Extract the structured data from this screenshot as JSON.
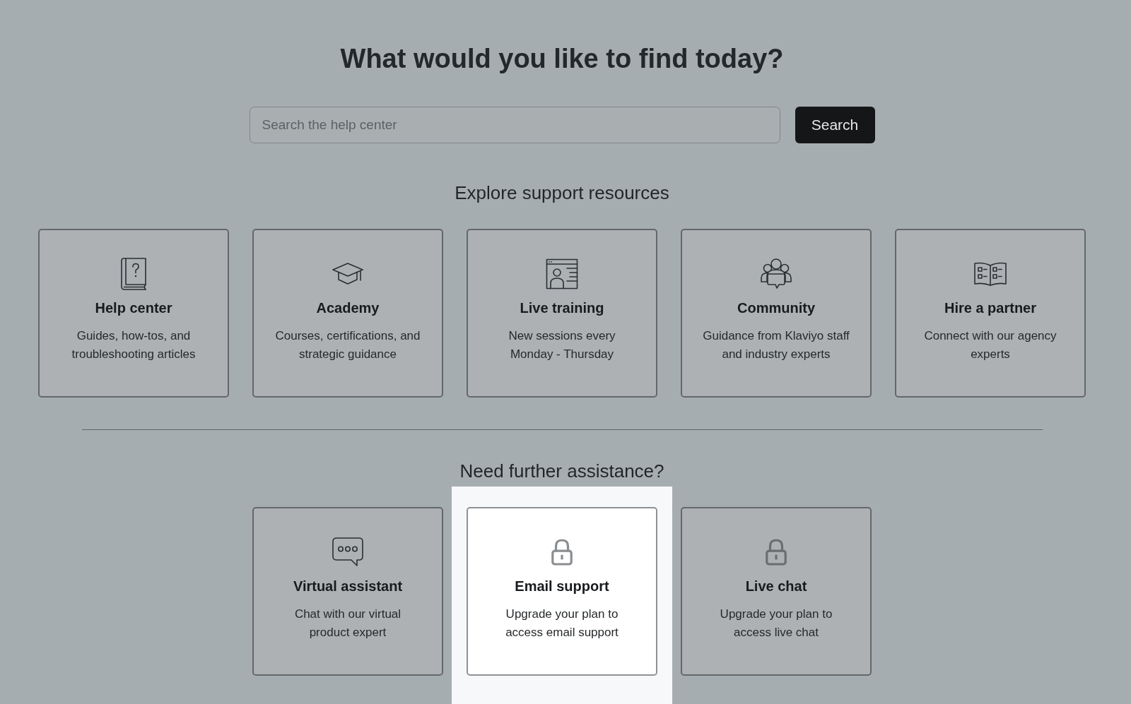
{
  "title": "What would you like to find today?",
  "search": {
    "placeholder": "Search the help center",
    "button": "Search"
  },
  "resources": {
    "heading": "Explore support resources",
    "cards": [
      {
        "title": "Help center",
        "description": "Guides, how-tos, and\ntroubleshooting articles"
      },
      {
        "title": "Academy",
        "description": "Courses, certifications, and\nstrategic guidance"
      },
      {
        "title": "Live training",
        "description": "New sessions every\nMonday - Thursday"
      },
      {
        "title": "Community",
        "description": "Guidance from Klaviyo staff\nand industry experts"
      },
      {
        "title": "Hire a partner",
        "description": "Connect with our agency\nexperts"
      }
    ]
  },
  "assistance": {
    "heading": "Need further assistance?",
    "cards": [
      {
        "title": "Virtual assistant",
        "description": "Chat with our virtual\nproduct expert",
        "locked": false,
        "highlighted": false
      },
      {
        "title": "Email support",
        "description": "Upgrade your plan to\naccess email support",
        "locked": true,
        "highlighted": true
      },
      {
        "title": "Live chat",
        "description": "Upgrade your plan to\naccess live chat",
        "locked": true,
        "highlighted": false
      }
    ]
  }
}
